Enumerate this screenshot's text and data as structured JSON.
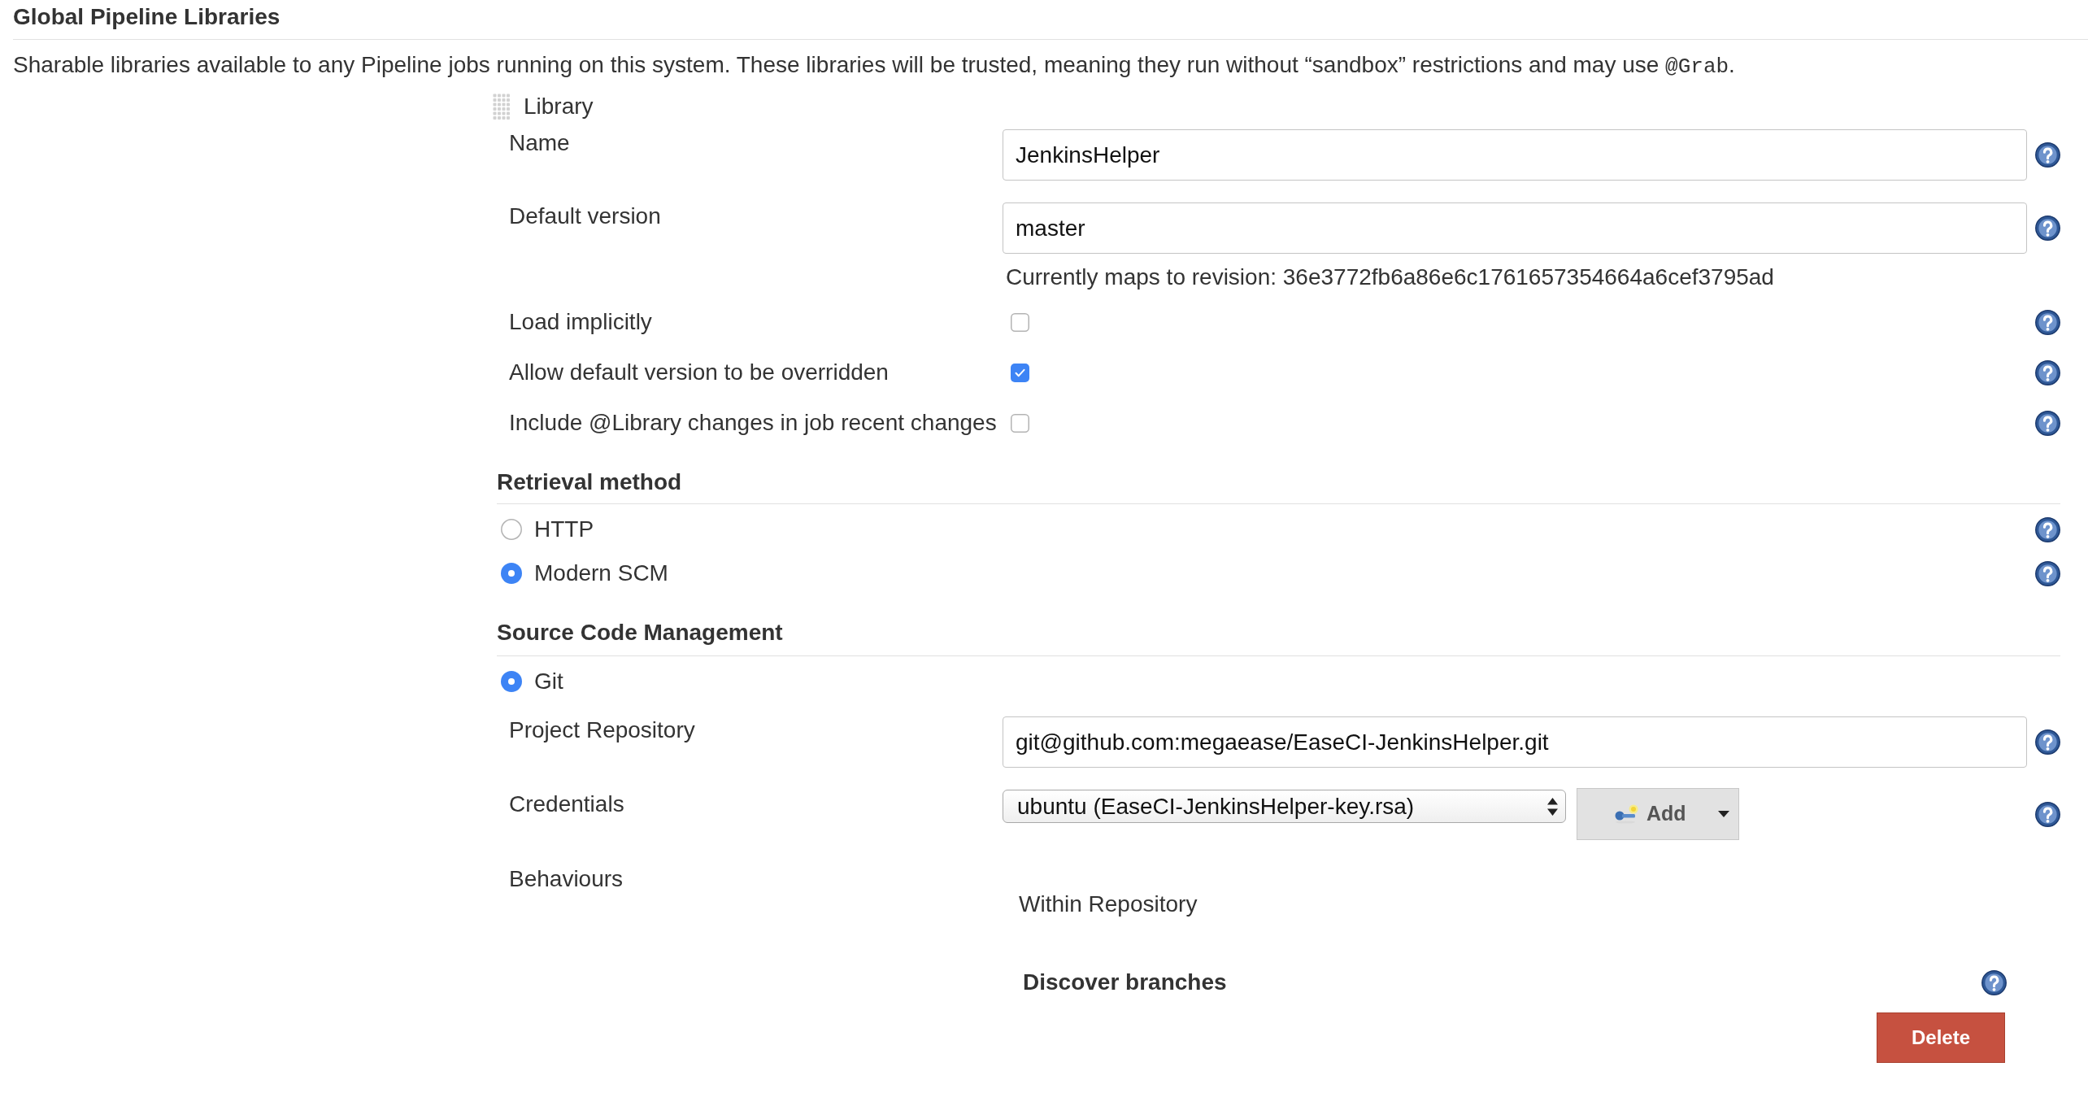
{
  "section": {
    "title": "Global Pipeline Libraries",
    "description": {
      "text": "Sharable libraries available to any Pipeline jobs running on this system. These libraries will be trusted, meaning they run without “sandbox” restrictions and may use",
      "code": "@Grab",
      "end": "."
    }
  },
  "library": {
    "header": "Library",
    "fields": [
      {
        "kind": "text",
        "label": "Name",
        "value": "JenkinsHelper"
      },
      {
        "kind": "text",
        "label": "Default version",
        "value": "master",
        "note": "Currently maps to revision: 36e3772fb6a86e6c1761657354664a6cef3795ad"
      },
      {
        "kind": "checkbox",
        "label": "Load implicitly",
        "checked": false
      },
      {
        "kind": "checkbox",
        "label": "Allow default version to be overridden",
        "checked": true
      },
      {
        "kind": "checkbox",
        "label": "Include @Library changes in job recent changes",
        "checked": false
      }
    ],
    "retrieval_method": {
      "title": "Retrieval method",
      "options": [
        {
          "label": "HTTP",
          "selected": false,
          "help": true
        },
        {
          "label": "Modern SCM",
          "selected": true,
          "help": true
        }
      ]
    },
    "source_code_management": {
      "title": "Source Code Management",
      "options": [
        {
          "label": "Git",
          "selected": true,
          "help": false
        }
      ],
      "fields": [
        {
          "kind": "text",
          "label": "Project Repository",
          "value": "git@github.com:megaease/EaseCI-JenkinsHelper.git"
        },
        {
          "kind": "select",
          "label": "Credentials",
          "value": "ubuntu (EaseCI-JenkinsHelper-key.rsa)",
          "button": "Add"
        },
        {
          "kind": "behaviours",
          "label": "Behaviours",
          "group": "Within Repository",
          "items": [
            {
              "label": "Discover branches"
            }
          ]
        }
      ]
    },
    "delete_button": "Delete"
  }
}
